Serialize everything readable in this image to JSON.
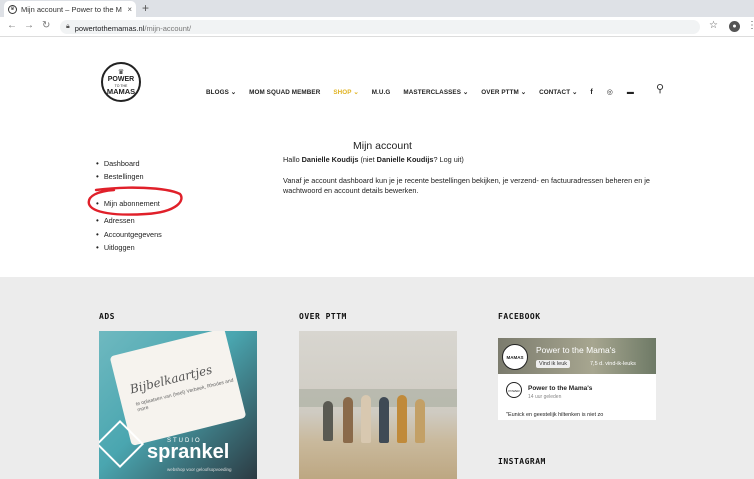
{
  "browser": {
    "tab_title": "Mijn account – Power to the M",
    "tab_close": "×",
    "new_tab": "+",
    "url_domain": "powertothemamas.nl",
    "url_path": "/mijn-account/"
  },
  "logo": {
    "top": "POWER",
    "middle": "TO THE",
    "bottom": "MAMAS"
  },
  "nav": {
    "items": [
      {
        "label": "BLOGS ⌄",
        "active": false
      },
      {
        "label": "MOM SQUAD MEMBER",
        "active": false
      },
      {
        "label": "SHOP ⌄",
        "active": true
      },
      {
        "label": "M.U.G",
        "active": false
      },
      {
        "label": "MASTERCLASSES ⌄",
        "active": false
      },
      {
        "label": "OVER PTTM ⌄",
        "active": false
      },
      {
        "label": "CONTACT ⌄",
        "active": false
      }
    ],
    "icons": [
      "facebook-icon",
      "instagram-icon",
      "cart-icon"
    ],
    "accent": "#e0b322"
  },
  "account": {
    "title": "Mijn account",
    "greeting_prefix": "Hallo ",
    "greeting_name": "Danielle Koudijs",
    "greeting_middle": " (niet ",
    "greeting_name2": "Danielle Koudijs",
    "greeting_suffix": "? Log uit)",
    "intro": "Vanaf je account dashboard kun je je recente bestellingen bekijken, je verzend- en factuuradressen beheren en je wachtwoord en account details bewerken.",
    "menu": [
      "Dashboard",
      "Bestellingen",
      "Mijn abonnement",
      "Adressen",
      "Accountgegevens",
      "Uitloggen"
    ]
  },
  "annotation": {
    "color": "#e0202a"
  },
  "footer": {
    "ads_title": "ADS",
    "ad_card_script": "Bijbelkaartjes",
    "ad_card_sub": "te oplaatsen van (heel) Verbeek, Rhodes and more",
    "ad_studio": "STUDIO",
    "ad_brand": "sprankel",
    "ad_tag": "webshop voor geloofsopvoeding",
    "over_title": "OVER PTTM",
    "facebook_title": "FACEBOOK",
    "fb_page_name": "Power to the Mama's",
    "fb_like_button": "Vind ik leuk",
    "fb_likes": "7,5 d. vind-ik-leuks",
    "fb_post_name": "Power to the Mama's",
    "fb_post_time": "14 uur geleden",
    "fb_post_text": "\"Eunick en geestelijk hiltenken is niet zo",
    "instagram_title": "INSTAGRAM"
  }
}
